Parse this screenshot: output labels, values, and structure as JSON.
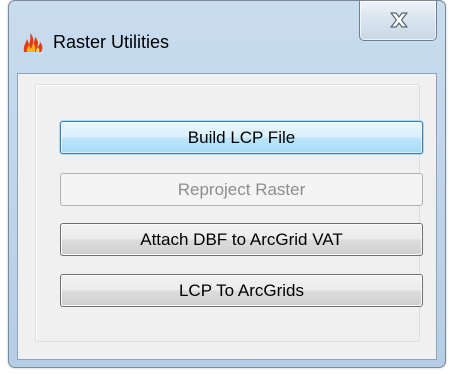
{
  "window": {
    "title": "Raster Utilities",
    "icon": "flame-icon",
    "close_icon": "close-icon"
  },
  "buttons": [
    {
      "label": "Build LCP File",
      "state": "focused"
    },
    {
      "label": "Reproject Raster",
      "state": "disabled"
    },
    {
      "label": "Attach DBF to ArcGrid VAT",
      "state": "normal"
    },
    {
      "label": "LCP To ArcGrids",
      "state": "normal"
    }
  ]
}
